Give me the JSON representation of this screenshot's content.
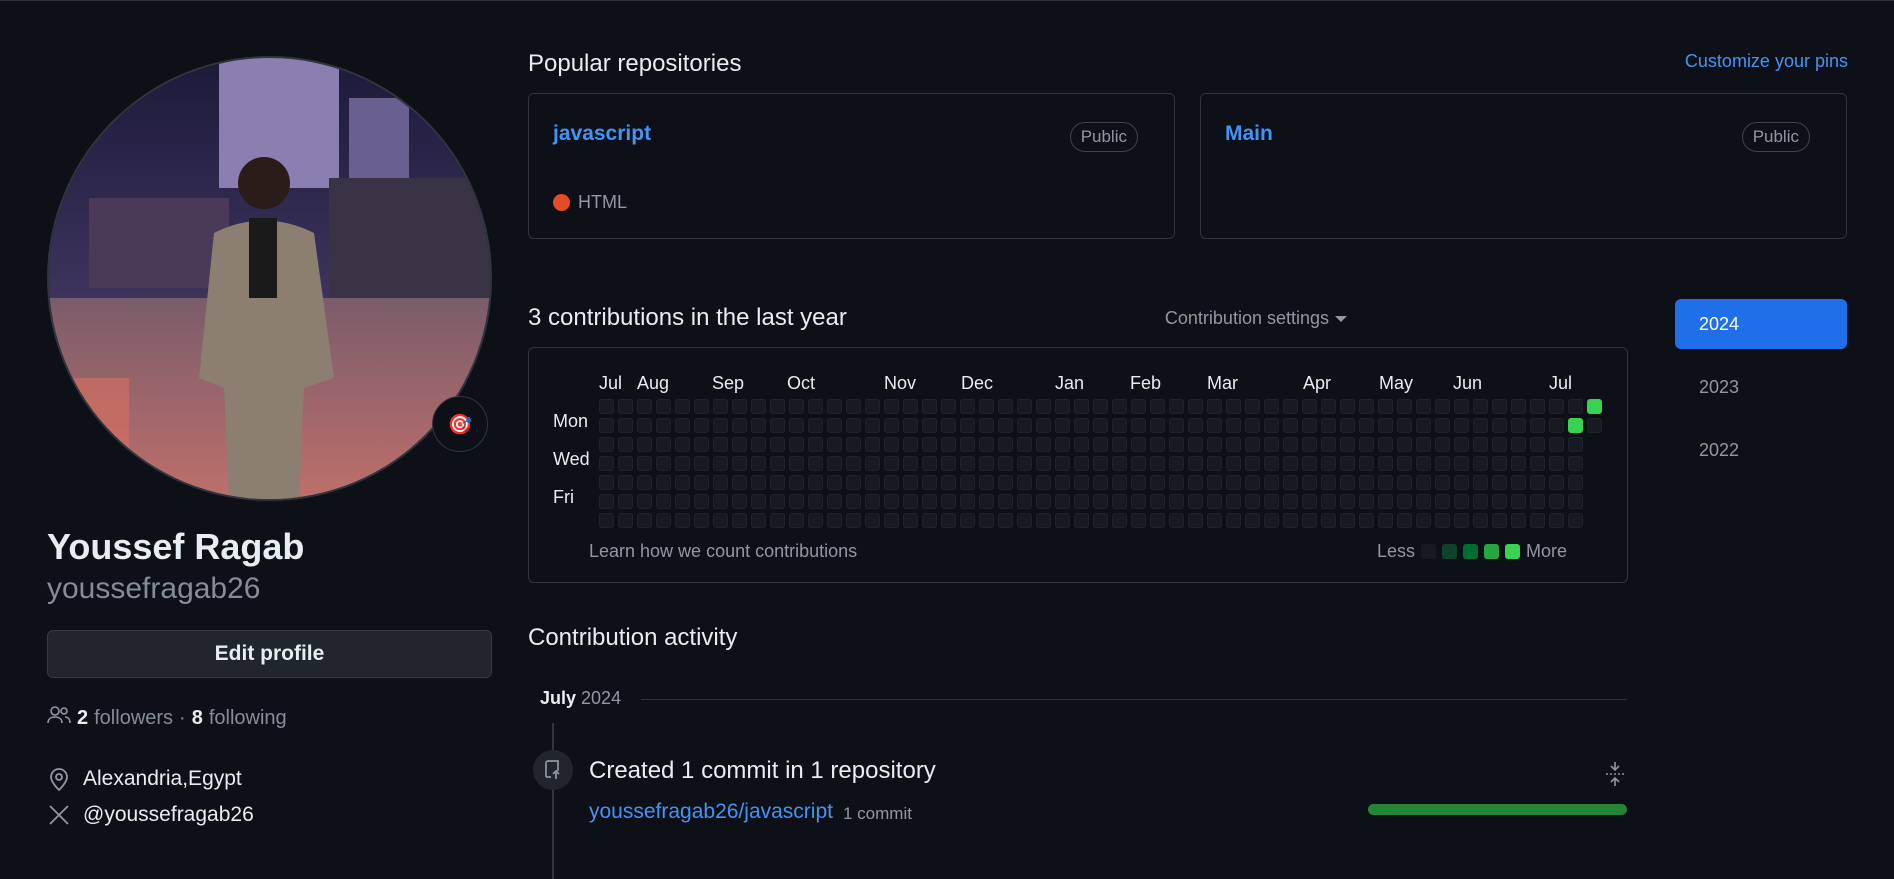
{
  "profile": {
    "full_name": "Youssef Ragab",
    "username": "youssefragab26",
    "status_emoji": "🎯",
    "edit_profile_label": "Edit profile",
    "followers_count": "2",
    "followers_label": "followers",
    "separator": "·",
    "following_count": "8",
    "following_label": "following",
    "location": "Alexandria,Egypt",
    "twitter": "@youssefragab26"
  },
  "pinned": {
    "title": "Popular repositories",
    "customize_label": "Customize your pins",
    "repos": [
      {
        "name": "javascript",
        "visibility": "Public",
        "language": "HTML",
        "language_color": "#e34c26"
      },
      {
        "name": "Main",
        "visibility": "Public"
      }
    ]
  },
  "contributions": {
    "title": "3 contributions in the last year",
    "settings_label": "Contribution settings",
    "months": [
      "Jul",
      "Aug",
      "Sep",
      "Oct",
      "Nov",
      "Dec",
      "Jan",
      "Feb",
      "Mar",
      "Apr",
      "May",
      "Jun",
      "Jul"
    ],
    "days": [
      "Mon",
      "Wed",
      "Fri"
    ],
    "learn_label": "Learn how we count contributions",
    "legend_less": "Less",
    "legend_more": "More",
    "legend_colors": [
      "#161b22",
      "#0e4429",
      "#006d32",
      "#26a641",
      "#39d353"
    ],
    "active_color": "#39d353"
  },
  "years": [
    "2024",
    "2023",
    "2022"
  ],
  "activity": {
    "title": "Contribution activity",
    "month": "July",
    "year": "2024",
    "event_title": "Created 1 commit in 1 repository",
    "repo": "youssefragab26/javascript",
    "commit_count": "1 commit",
    "bar_color": "#238636"
  }
}
